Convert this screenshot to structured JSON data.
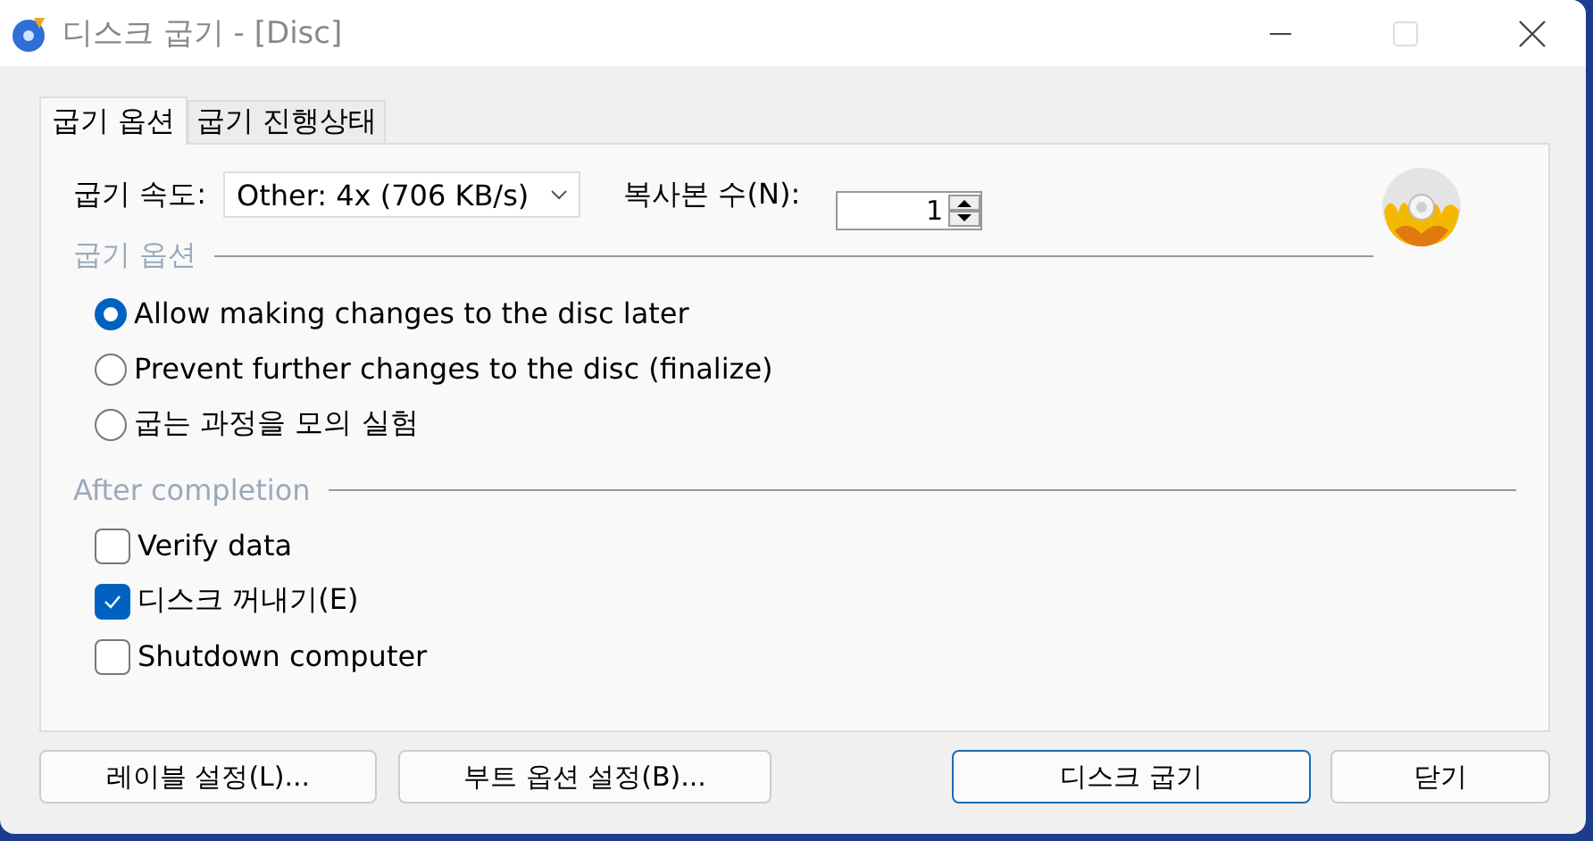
{
  "window": {
    "title": "디스크 굽기 - [Disc]"
  },
  "tabs": [
    {
      "label": "굽기 옵션",
      "selected": true
    },
    {
      "label": "굽기 진행상태",
      "selected": false
    }
  ],
  "speed": {
    "label": "굽기 속도:",
    "value": "Other: 4x (706 KB/s)"
  },
  "copies": {
    "label": "복사본 수(N):",
    "value": "1"
  },
  "burn_options": {
    "legend": "굽기 옵션",
    "options": [
      {
        "label": "Allow making changes to the disc later",
        "selected": true
      },
      {
        "label": "Prevent further changes to the disc (finalize)",
        "selected": false
      },
      {
        "label": "굽는 과정을 모의 실험",
        "selected": false
      }
    ]
  },
  "after_completion": {
    "legend": "After completion",
    "items": [
      {
        "label": "Verify data",
        "checked": false
      },
      {
        "label": "디스크 꺼내기(E)",
        "checked": true
      },
      {
        "label": "Shutdown computer",
        "checked": false
      }
    ]
  },
  "buttons": [
    {
      "label": "레이블 설정(L)...",
      "focused": false
    },
    {
      "label": "부트 옵션 설정(B)...",
      "focused": false
    },
    {
      "label": "디스크 굽기",
      "focused": true
    },
    {
      "label": "닫기",
      "focused": false
    }
  ]
}
